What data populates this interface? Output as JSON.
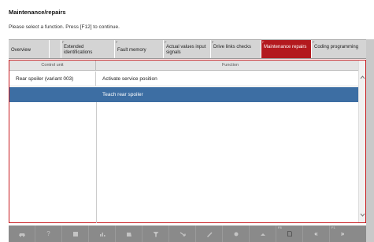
{
  "header": {
    "title": "Maintenance/repairs",
    "instruction": "Please select a function. Press [F12] to continue."
  },
  "tabs": [
    {
      "label": "Overview",
      "fkey": ""
    },
    {
      "label": "Extended identifications",
      "fkey": "F"
    },
    {
      "label": "Fault memory",
      "fkey": "F"
    },
    {
      "label": "Actual values input signals",
      "fkey": "F"
    },
    {
      "label": "Drive links checks",
      "fkey": "F"
    },
    {
      "label": "Maintenance repairs",
      "fkey": "F"
    },
    {
      "label": "Coding programming",
      "fkey": "F"
    }
  ],
  "grid": {
    "col_control_unit": "Control unit",
    "col_function": "Function",
    "rows": [
      {
        "control_unit": "Rear spoiler (variant 003)",
        "function": "Activate service position"
      },
      {
        "control_unit": "",
        "function": "Teach rear spoiler"
      }
    ]
  },
  "toolbar": {
    "fkey_label": "F8",
    "fkey_label_2": "F1",
    "icons": [
      "car-icon",
      "help-icon",
      "list-icon",
      "chart-icon",
      "clipboard-icon",
      "filter-icon",
      "arrow-icon",
      "pen-icon",
      "record-icon",
      "person-icon",
      "document-icon",
      "back-icon",
      "forward-icon"
    ],
    "help_glyph": "?",
    "back_glyph": "«",
    "forward_glyph": "»"
  },
  "colors": {
    "accent_red": "#b3191e",
    "selection_blue": "#3d6ea3",
    "toolbar_gray": "#8a8a8a"
  }
}
